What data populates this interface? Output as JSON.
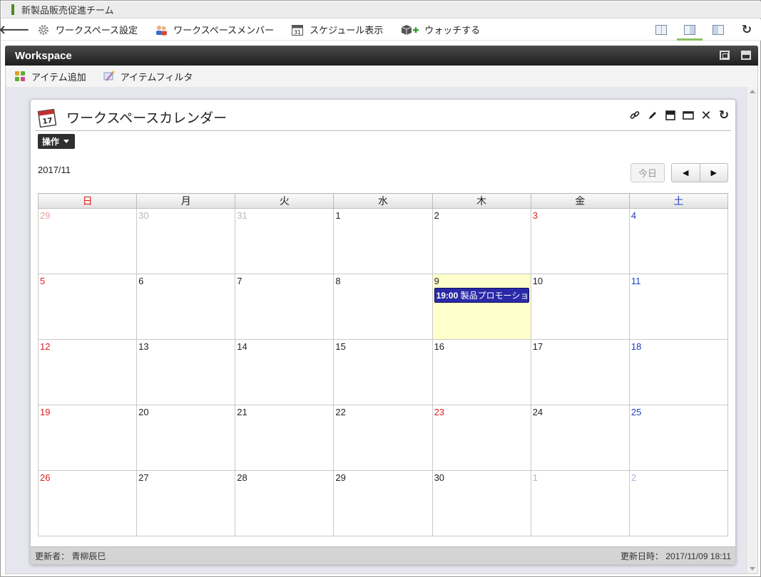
{
  "header": {
    "title": "新製品販売促進チーム"
  },
  "toolbar": {
    "back_icon": "arrow-left-icon",
    "items": [
      {
        "label": "ワークスペース設定",
        "icon": "gear-icon"
      },
      {
        "label": "ワークスペースメンバー",
        "icon": "members-icon"
      },
      {
        "label": "スケジュール表示",
        "icon": "calendar-icon"
      },
      {
        "label": "ウォッチする",
        "icon": "watch-add-icon"
      }
    ],
    "right_icons": [
      "single-pane-icon",
      "right-pane-icon",
      "left-pane-icon",
      "refresh-icon"
    ]
  },
  "workspace": {
    "title": "Workspace",
    "actions": [
      {
        "label": "アイテム追加",
        "icon": "puzzle-add-icon"
      },
      {
        "label": "アイテムフィルタ",
        "icon": "filter-wand-icon"
      }
    ]
  },
  "portlet": {
    "title": "ワークスペースカレンダー",
    "tools": [
      "link-icon",
      "edit-icon",
      "minimize-icon",
      "maximize-icon",
      "close-icon",
      "refresh-icon"
    ],
    "ops_label": "操作",
    "month_label": "2017/11",
    "today_label": "今日",
    "prev_label": "◀",
    "next_label": "▶",
    "weekdays": [
      "日",
      "月",
      "火",
      "水",
      "木",
      "金",
      "土"
    ],
    "weeks": [
      [
        {
          "day": "29",
          "other": true
        },
        {
          "day": "30",
          "other": true
        },
        {
          "day": "31",
          "other": true
        },
        {
          "day": "1"
        },
        {
          "day": "2"
        },
        {
          "day": "3",
          "holiday": true
        },
        {
          "day": "4"
        }
      ],
      [
        {
          "day": "5"
        },
        {
          "day": "6"
        },
        {
          "day": "7"
        },
        {
          "day": "8"
        },
        {
          "day": "9",
          "today": true,
          "events": [
            {
              "time": "19:00",
              "title": "製品プロモーション"
            }
          ]
        },
        {
          "day": "10"
        },
        {
          "day": "11"
        }
      ],
      [
        {
          "day": "12"
        },
        {
          "day": "13"
        },
        {
          "day": "14"
        },
        {
          "day": "15"
        },
        {
          "day": "16"
        },
        {
          "day": "17"
        },
        {
          "day": "18"
        }
      ],
      [
        {
          "day": "19"
        },
        {
          "day": "20"
        },
        {
          "day": "21"
        },
        {
          "day": "22"
        },
        {
          "day": "23",
          "holiday": true
        },
        {
          "day": "24"
        },
        {
          "day": "25"
        }
      ],
      [
        {
          "day": "26"
        },
        {
          "day": "27"
        },
        {
          "day": "28"
        },
        {
          "day": "29"
        },
        {
          "day": "30"
        },
        {
          "day": "1",
          "other": true
        },
        {
          "day": "2",
          "other": true
        }
      ]
    ],
    "footer": {
      "updater": "更新者： 青柳辰巳",
      "updated_at": "更新日時： 2017/11/09 18:11"
    }
  },
  "colors": {
    "sunday": "#e02020",
    "saturday": "#2040c0",
    "today_bg": "#ffffcc",
    "event_bg": "#2a2aa8",
    "header_dark": "#2a2a2a",
    "accent_green": "#8cc060"
  }
}
